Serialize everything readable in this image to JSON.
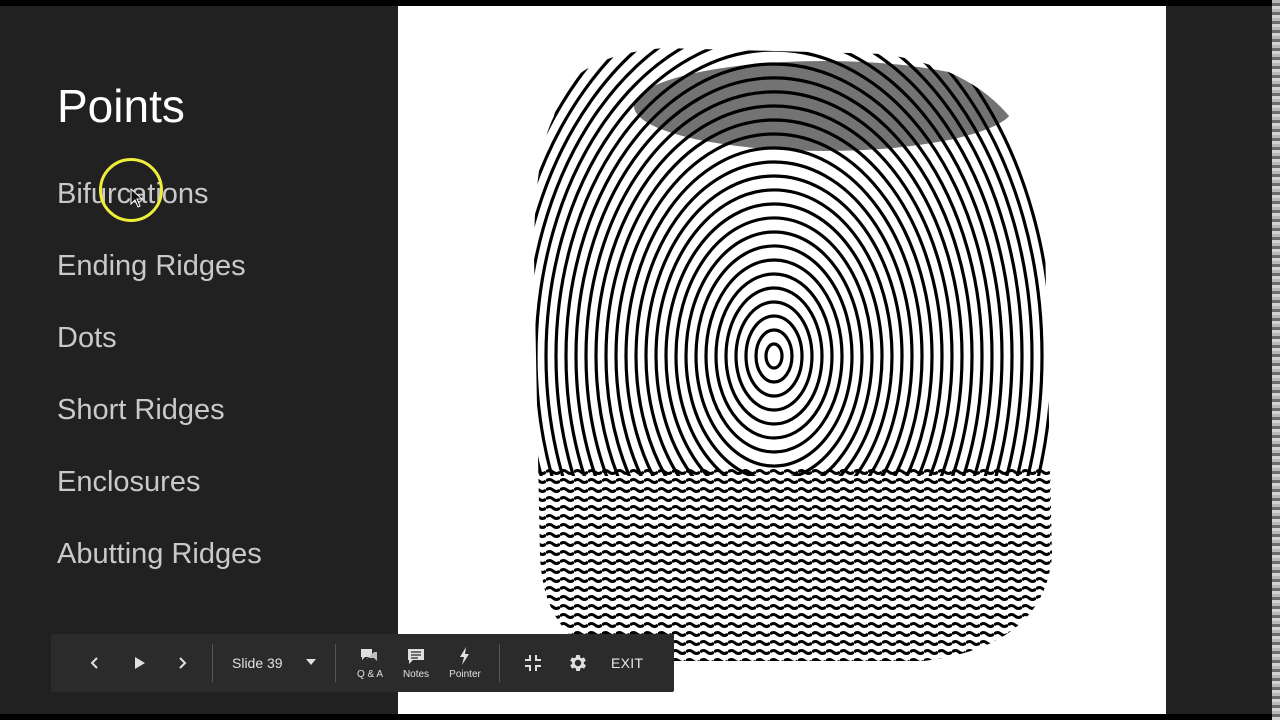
{
  "slide": {
    "title": "Points",
    "bullets": [
      "Bifurcations",
      "Ending Ridges",
      "Dots",
      "Short Ridges",
      "Enclosures",
      "Abutting Ridges"
    ],
    "image_description_icon": "fingerprint-icon"
  },
  "toolbar": {
    "prev_icon": "chevron-left-icon",
    "play_icon": "play-icon",
    "next_icon": "chevron-right-icon",
    "slide_label": "Slide 39",
    "qa_label": "Q & A",
    "notes_label": "Notes",
    "pointer_label": "Pointer",
    "exit_label": "EXIT"
  },
  "colors": {
    "slide_bg": "#212121",
    "title_text": "#ffffff",
    "bullet_text": "#c9c9c9",
    "laser_ring": "#eded3a",
    "toolbar_bg": "#2b2b2b"
  }
}
